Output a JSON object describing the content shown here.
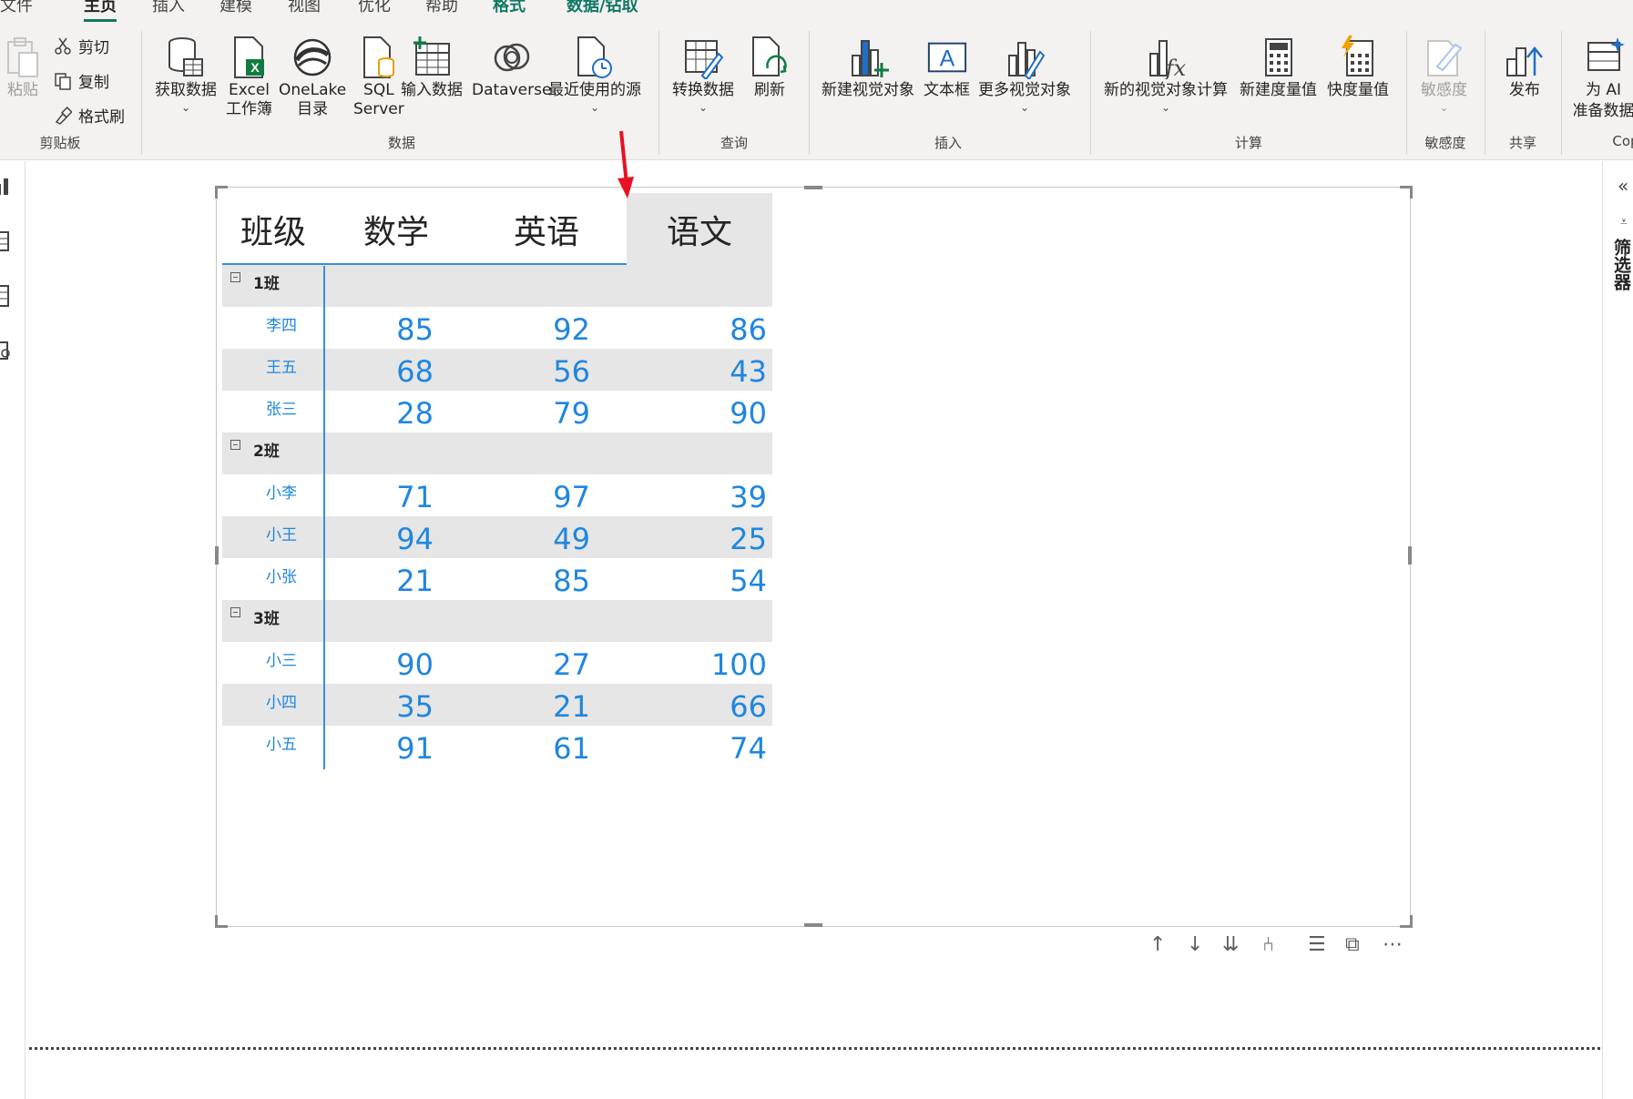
{
  "ribbon_tabs": [
    {
      "label": "文件",
      "state": "normal"
    },
    {
      "label": "主页",
      "state": "active"
    },
    {
      "label": "插入",
      "state": "normal"
    },
    {
      "label": "建模",
      "state": "normal"
    },
    {
      "label": "视图",
      "state": "normal"
    },
    {
      "label": "优化",
      "state": "normal"
    },
    {
      "label": "帮助",
      "state": "normal"
    },
    {
      "label": "格式",
      "state": "green"
    },
    {
      "label": "数据/钻取",
      "state": "green"
    }
  ],
  "clipboard": {
    "group": "剪贴板",
    "paste": "粘贴",
    "cut": "剪切",
    "copy": "复制",
    "format_painter": "格式刷"
  },
  "data_group": {
    "group": "数据",
    "get_data": "获取数据",
    "excel_1": "Excel",
    "excel_2": "工作簿",
    "onelake_1": "OneLake",
    "onelake_2": "目录",
    "sql_1": "SQL",
    "sql_2": "Server",
    "enter_data": "输入数据",
    "dataverse": "Dataverse",
    "recent": "最近使用的源"
  },
  "query_group": {
    "group": "查询",
    "transform": "转换数据",
    "refresh": "刷新"
  },
  "insert_group": {
    "group": "插入",
    "new_visual": "新建视觉对象",
    "text_box": "文本框",
    "more_visuals": "更多视觉对象"
  },
  "calc_group": {
    "group": "计算",
    "new_visual_calc": "新的视觉对象计算",
    "new_measure": "新建度量值",
    "quick_measure": "快度量值"
  },
  "sensitivity_group": {
    "group": "敏感度",
    "sensitivity": "敏感度"
  },
  "share_group": {
    "group": "共享",
    "publish": "发布"
  },
  "copilot_group": {
    "group": "Cop",
    "ai_1": "为 AI",
    "ai_2": "准备数据"
  },
  "right_panel": {
    "filters": "筛选器",
    "collapse": "«"
  },
  "matrix": {
    "headers": [
      "班级",
      "数学",
      "英语",
      "语文"
    ],
    "groups": [
      {
        "name": "1班",
        "rows": [
          {
            "name": "李四",
            "math": "85",
            "english": "92",
            "chinese": "86"
          },
          {
            "name": "王五",
            "math": "68",
            "english": "56",
            "chinese": "43"
          },
          {
            "name": "张三",
            "math": "28",
            "english": "79",
            "chinese": "90"
          }
        ]
      },
      {
        "name": "2班",
        "rows": [
          {
            "name": "小李",
            "math": "71",
            "english": "97",
            "chinese": "39"
          },
          {
            "name": "小王",
            "math": "94",
            "english": "49",
            "chinese": "25"
          },
          {
            "name": "小张",
            "math": "21",
            "english": "85",
            "chinese": "54"
          }
        ]
      },
      {
        "name": "3班",
        "rows": [
          {
            "name": "小三",
            "math": "90",
            "english": "27",
            "chinese": "100"
          },
          {
            "name": "小四",
            "math": "35",
            "english": "21",
            "chinese": "66"
          },
          {
            "name": "小五",
            "math": "91",
            "english": "61",
            "chinese": "74"
          }
        ]
      }
    ]
  },
  "colors": {
    "accent_green": "#117865",
    "value_blue": "#1f86e0",
    "row_shade": "#e6e6e6",
    "arrow_red": "#e81123"
  }
}
